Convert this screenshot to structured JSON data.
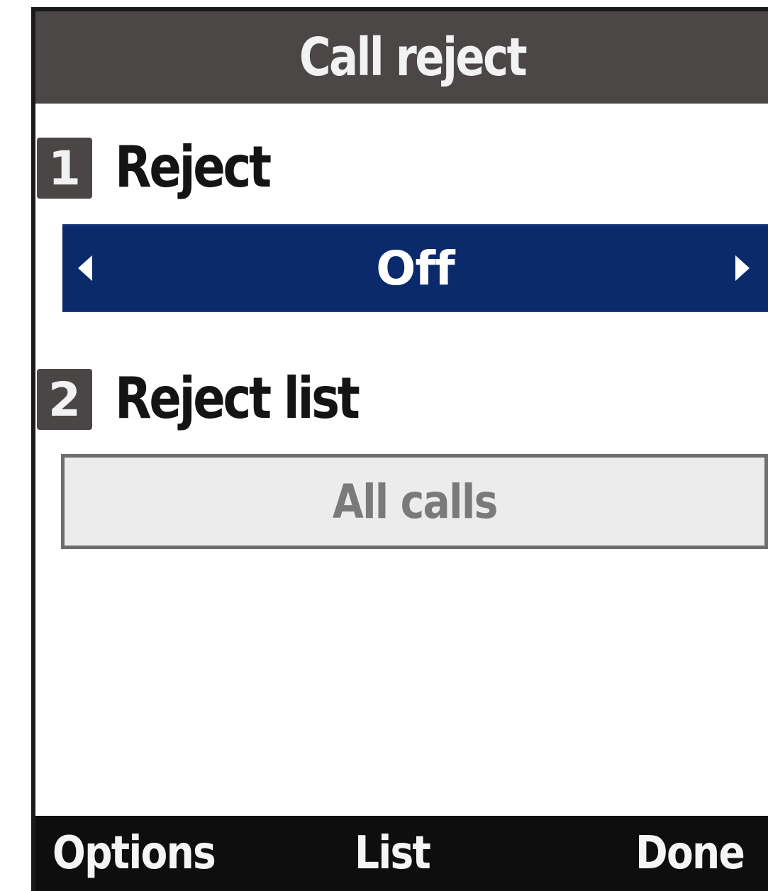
{
  "screen": {
    "title": "Call reject"
  },
  "items": [
    {
      "number": "1",
      "label": "Reject",
      "value": "Off"
    },
    {
      "number": "2",
      "label": "Reject list",
      "value": "All calls"
    }
  ],
  "softkeys": {
    "left": "Options",
    "center": "List",
    "right": "Done"
  },
  "colors": {
    "title_bar": "#4b4747",
    "selection": "#0b2a6b",
    "softkey_bar": "#0e0e0e",
    "field_bg": "#ececec"
  },
  "icons": {
    "selector_left": "triangle-left-icon",
    "selector_right": "triangle-right-icon"
  }
}
